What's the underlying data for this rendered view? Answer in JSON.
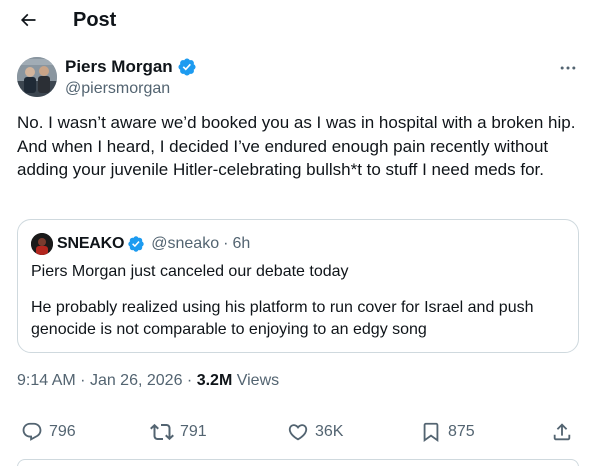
{
  "header": {
    "back_icon": "arrow-left-icon",
    "title": "Post"
  },
  "author": {
    "name": "Piers Morgan",
    "handle": "@piersmorgan",
    "verified_icon": "verified-badge-icon"
  },
  "more_icon": "ellipsis-icon",
  "tweet_text": "No. I wasn’t aware we’d booked you as I was in hospital with a broken hip. And when I heard, I decided I’ve endured enough pain recently without adding your juvenile Hitler-celebrating bullsh*t to stuff I need meds for.",
  "quote": {
    "name": "SNEAKO",
    "handle": "@sneako",
    "dot": "·",
    "time": "6h",
    "para1": "Piers Morgan just canceled our debate today",
    "para2": "He probably realized using his platform to run cover for Israel and push genocide is not comparable to enjoying to an edgy song"
  },
  "meta": {
    "time": "9:14 AM",
    "sep1": "·",
    "date": "Jan 26, 2026",
    "sep2": "·",
    "views_count": "3.2M",
    "views_label": "Views"
  },
  "actions": {
    "replies": "796",
    "reposts": "791",
    "likes": "36K",
    "bookmarks": "875"
  },
  "colors": {
    "text": "#0f1419",
    "secondary": "#536471",
    "verified": "#1d9bf0",
    "border": "#cfd9de"
  }
}
